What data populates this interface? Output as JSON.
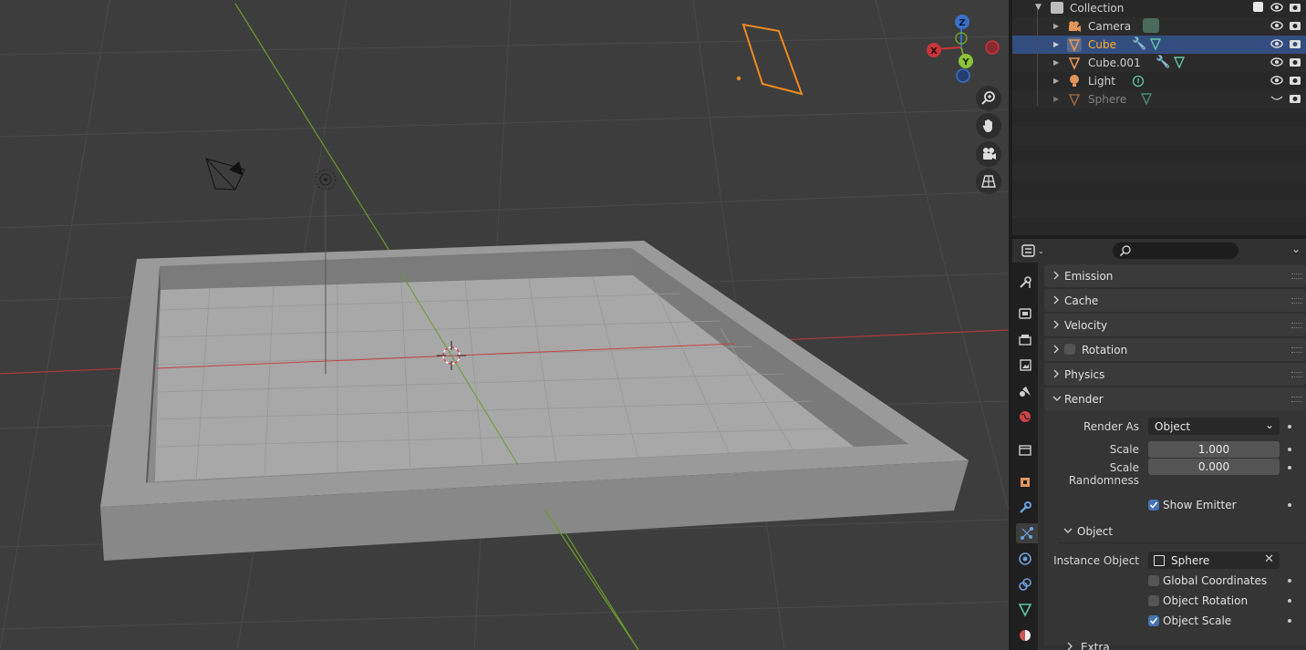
{
  "outliner": {
    "rows": [
      {
        "label": "Collection",
        "icon": "collection-icon"
      },
      {
        "label": "Camera",
        "icon": "camera-object-icon"
      },
      {
        "label": "Cube",
        "icon": "mesh-object-icon",
        "selected": true
      },
      {
        "label": "Cube.001",
        "icon": "mesh-object-icon"
      },
      {
        "label": "Light",
        "icon": "light-object-icon"
      },
      {
        "label": "Sphere",
        "icon": "mesh-object-icon",
        "hidden": true
      }
    ]
  },
  "gizmo": {
    "x": "X",
    "y": "Y",
    "z": "Z"
  },
  "panels": {
    "emission": "Emission",
    "cache": "Cache",
    "velocity": "Velocity",
    "rotation": "Rotation",
    "physics": "Physics",
    "render": "Render",
    "object": "Object",
    "extra": "Extra"
  },
  "render": {
    "render_as_label": "Render As",
    "render_as_value": "Object",
    "scale_label": "Scale",
    "scale_value": "1.000",
    "scale_rand_label": "Scale Randomness",
    "scale_rand_value": "0.000",
    "show_emitter": "Show Emitter",
    "show_emitter_checked": true
  },
  "object": {
    "instance_label": "Instance Object",
    "instance_value": "Sphere",
    "global_coords": "Global Coordinates",
    "global_coords_checked": false,
    "object_rotation": "Object Rotation",
    "object_rotation_checked": false,
    "object_scale": "Object Scale",
    "object_scale_checked": true
  },
  "colors": {
    "selection": "#334d80",
    "selected_text": "#ffaf29",
    "checkbox_on": "#4772b3",
    "x_axis": "#c9353b",
    "y_axis": "#6ea02b"
  }
}
